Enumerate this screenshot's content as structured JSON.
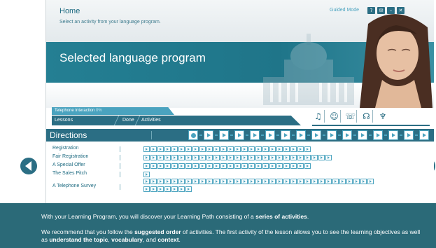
{
  "header": {
    "title": "Home",
    "subtitle": "Select an activity from your language program.",
    "guided_mode": "Guided Mode",
    "window_buttons": [
      {
        "name": "help-icon",
        "glyph": "?"
      },
      {
        "name": "mail-icon",
        "glyph": "✉"
      },
      {
        "name": "minimize-icon",
        "glyph": "–"
      },
      {
        "name": "close-icon",
        "glyph": "✕"
      }
    ]
  },
  "banner": {
    "title": "Selected language program"
  },
  "tabs": {
    "current_label": "Telephone Interaction",
    "current_progress": "0%",
    "lessons": "Lessons",
    "done": "Done",
    "activities": "Activities"
  },
  "tool_icons": [
    "speak-icon",
    "listen-icon",
    "record-icon",
    "compare-icon",
    "dictionary-icon"
  ],
  "directions": {
    "title": "Directions",
    "step_count": 16
  },
  "lessons": [
    {
      "name": "Registration",
      "activities": 24
    },
    {
      "name": "Fair Registration",
      "activities": 27
    },
    {
      "name": "A Special Offer",
      "activities": 24
    },
    {
      "name": "The Sales Pitch",
      "activities": 1
    },
    {
      "name": "A Telephone Survey",
      "activities": 33,
      "second_row": 7
    }
  ],
  "footer": {
    "p1_a": "With your Learning Program, you will discover your Learning Path consisting of a ",
    "p1_b": "series of activities",
    "p1_c": ".",
    "p2_a": "We recommend that you follow the ",
    "p2_b": "suggested order",
    "p2_c": " of activities. The first activity of the lesson allows you to see the learning objectives as well as ",
    "p2_d": "understand the topic",
    "p2_e": ", ",
    "p2_f": "vocabulary",
    "p2_g": ", and ",
    "p2_h": "context",
    "p2_i": "."
  },
  "colors": {
    "accent": "#2b6e84",
    "light_accent": "#4aa3bf",
    "footer_bg": "#2b6a78"
  }
}
